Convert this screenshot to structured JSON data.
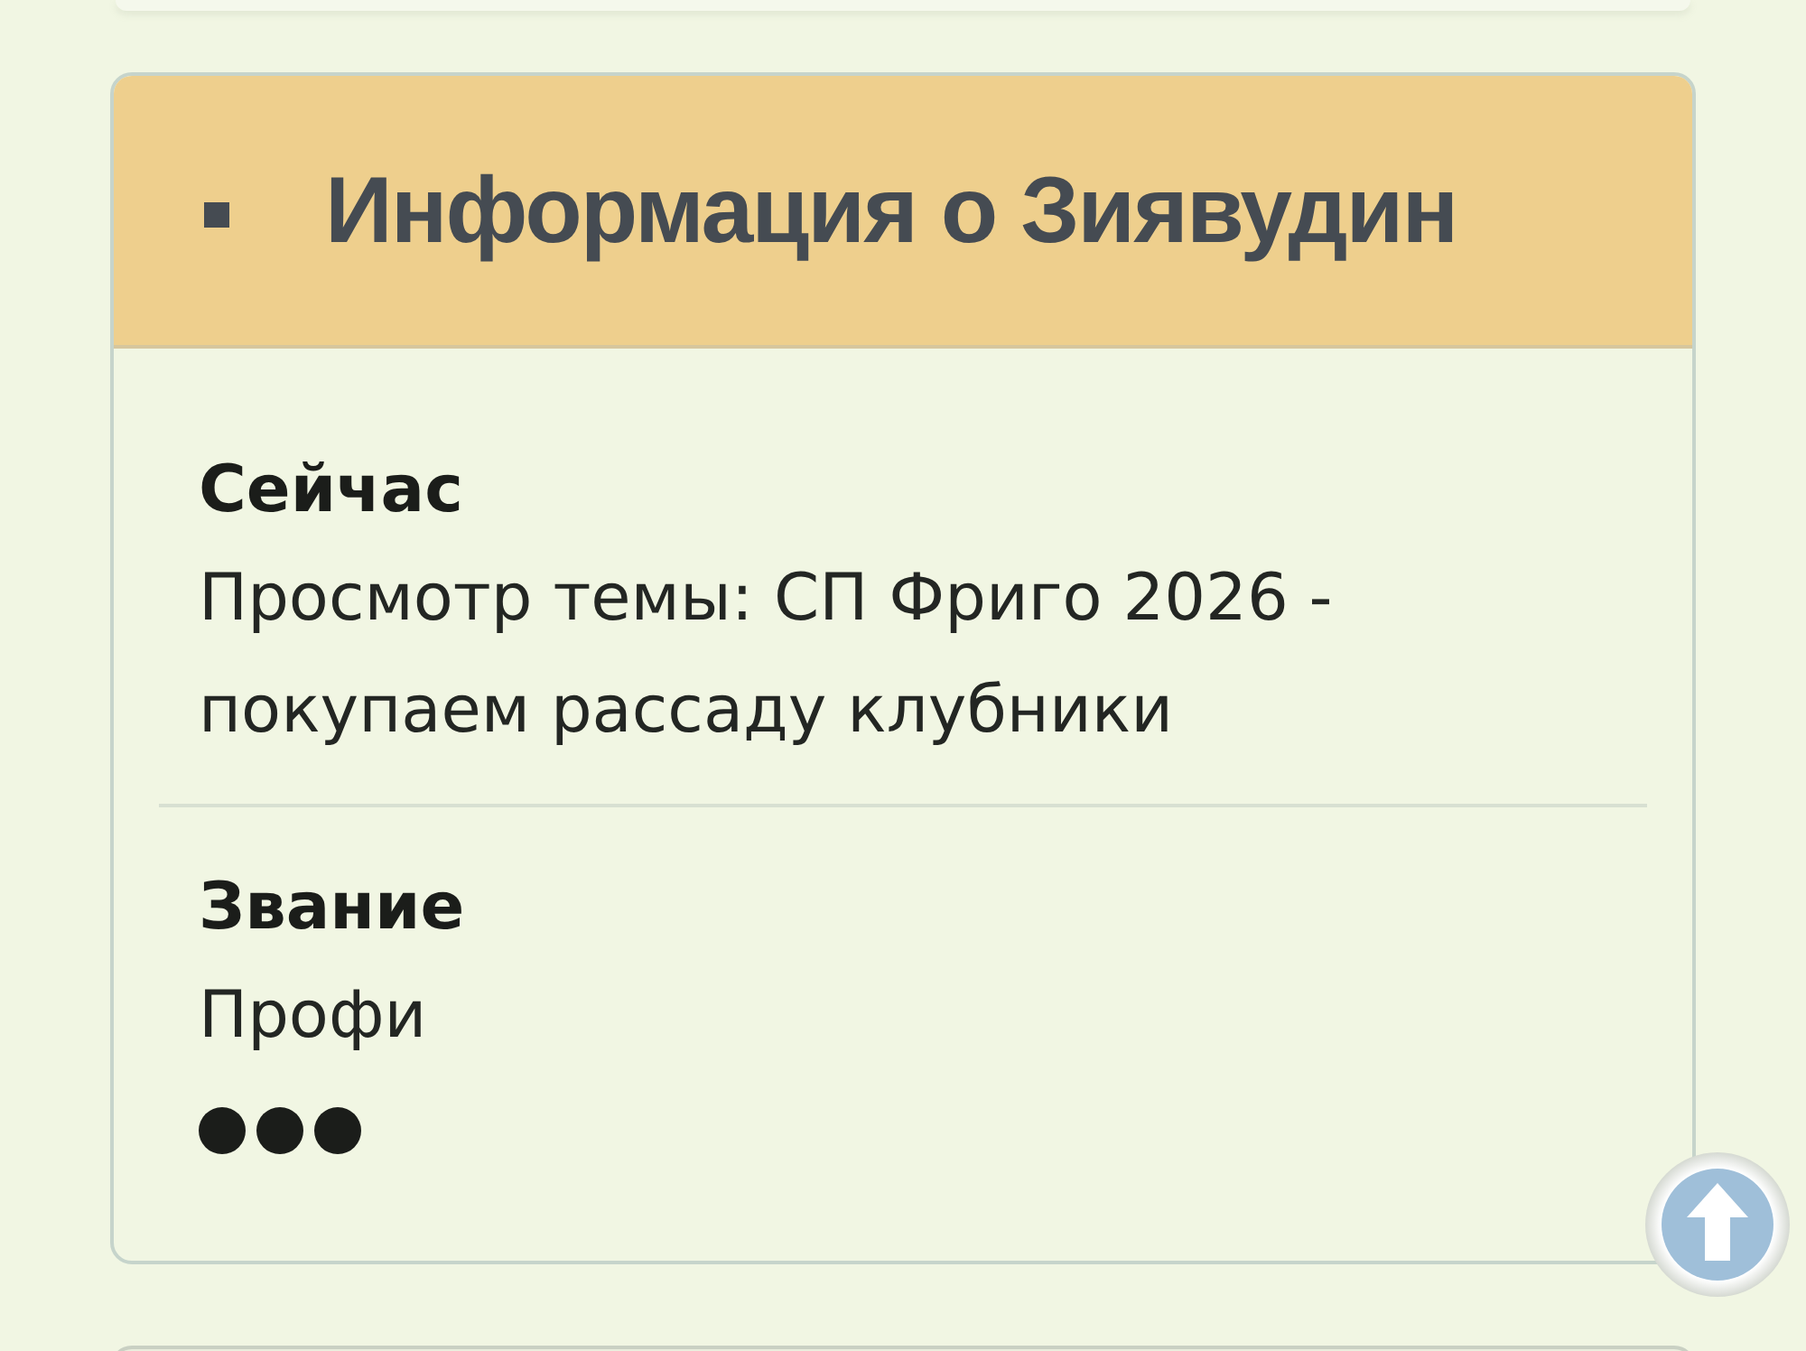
{
  "panel": {
    "title": "Информация о Зиявудин",
    "fields": [
      {
        "label": "Сейчас",
        "value": "Просмотр темы: СП Фриго 2026 - покупаем рассаду клубники"
      },
      {
        "label": "Звание",
        "value": "Профи",
        "stars": 3
      }
    ]
  }
}
